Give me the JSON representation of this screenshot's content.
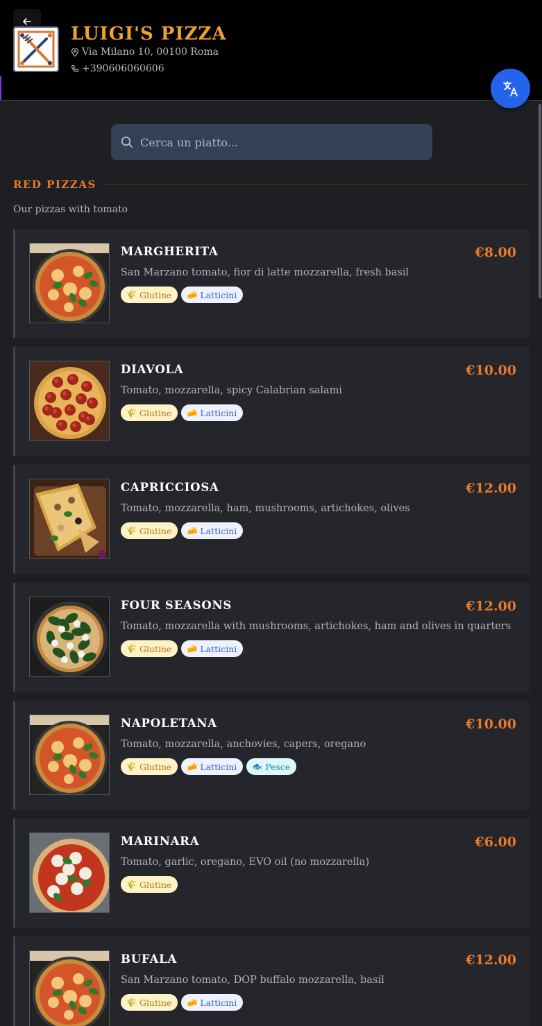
{
  "header": {
    "restaurant_name": "LUIGI'S PIZZA",
    "address": "Via Milano 10, 00100 Roma",
    "phone": "+390606060606"
  },
  "search": {
    "placeholder": "Cerca un piatto..."
  },
  "section": {
    "title": "RED PIZZAS",
    "subtitle": "Our pizzas with tomato"
  },
  "allergens": {
    "gluten": {
      "label": "Glutine",
      "icon": "wheat-icon"
    },
    "dairy": {
      "label": "Latticini",
      "icon": "cheese-icon"
    },
    "fish": {
      "label": "Pesce",
      "icon": "fish-icon"
    }
  },
  "items": [
    {
      "name": "MARGHERITA",
      "price": "€8.00",
      "description": "San Marzano tomato, fior di latte mozzarella, fresh basil",
      "allergens": [
        "gluten",
        "dairy"
      ],
      "image": "margherita-pizza"
    },
    {
      "name": "DIAVOLA",
      "price": "€10.00",
      "description": "Tomato, mozzarella, spicy Calabrian salami",
      "allergens": [
        "gluten",
        "dairy"
      ],
      "image": "pepperoni-pizza"
    },
    {
      "name": "CAPRICCIOSA",
      "price": "€12.00",
      "description": "Tomato, mozzarella, ham, mushrooms, artichokes, olives",
      "allergens": [
        "gluten",
        "dairy"
      ],
      "image": "capricciosa-pizza"
    },
    {
      "name": "FOUR SEASONS",
      "price": "€12.00",
      "description": "Tomato, mozzarella with mushrooms, artichokes, ham and olives in quarters",
      "allergens": [
        "gluten",
        "dairy"
      ],
      "image": "spinach-pizza"
    },
    {
      "name": "NAPOLETANA",
      "price": "€10.00",
      "description": "Tomato, mozzarella, anchovies, capers, oregano",
      "allergens": [
        "gluten",
        "dairy",
        "fish"
      ],
      "image": "margherita-pizza"
    },
    {
      "name": "MARINARA",
      "price": "€6.00",
      "description": "Tomato, garlic, oregano, EVO oil (no mozzarella)",
      "allergens": [
        "gluten"
      ],
      "image": "marinara-pizza"
    },
    {
      "name": "BUFALA",
      "price": "€12.00",
      "description": "San Marzano tomato, DOP buffalo mozzarella, basil",
      "allergens": [
        "gluten",
        "dairy"
      ],
      "image": "margherita-pizza"
    }
  ],
  "colors": {
    "accent": "#e8792a",
    "title": "#f0a030",
    "translate_button": "#2563eb",
    "search_bg": "#334155"
  }
}
